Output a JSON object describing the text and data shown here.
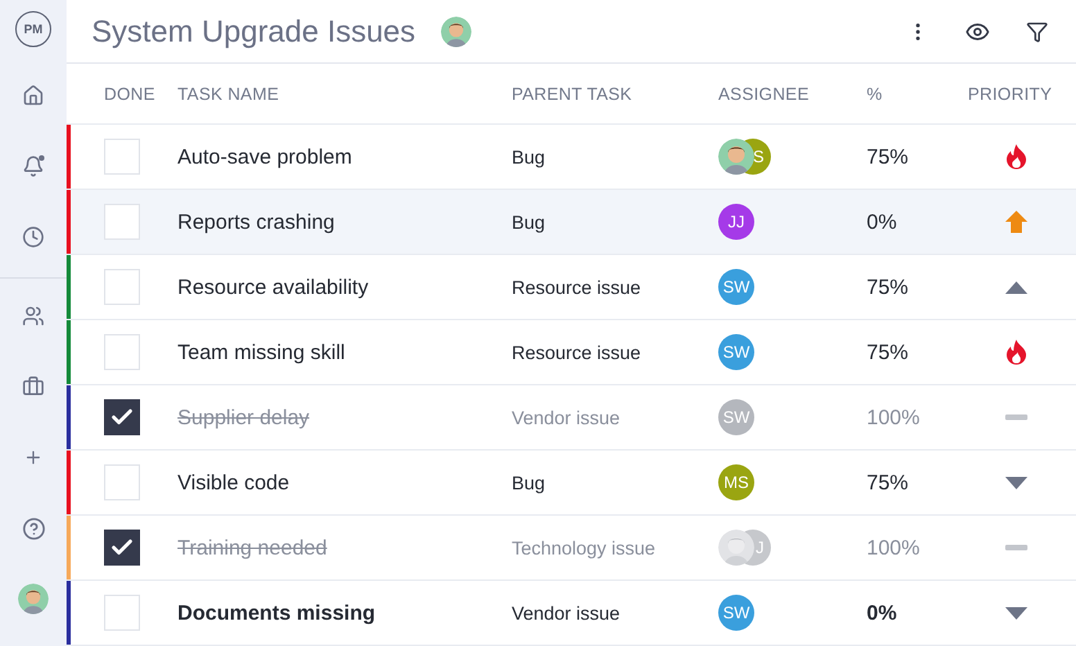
{
  "sidebar": {
    "logo": "PM",
    "items": [
      {
        "kind": "home"
      },
      {
        "kind": "bell"
      },
      {
        "kind": "clock"
      },
      {
        "kind": "users"
      },
      {
        "kind": "briefcase"
      },
      {
        "kind": "plus"
      },
      {
        "kind": "help"
      },
      {
        "kind": "avatar"
      }
    ]
  },
  "header": {
    "title": "System Upgrade Issues"
  },
  "table": {
    "columns": [
      "DONE",
      "TASK NAME",
      "PARENT TASK",
      "ASSIGNEE",
      "%",
      "PRIORITY"
    ],
    "rows": [
      {
        "done": false,
        "selected": false,
        "bold": false,
        "color": "#e8101f",
        "task": "Auto-save problem",
        "parent": "Bug",
        "assignees": [
          {
            "kind": "face"
          },
          {
            "kind": "initials",
            "initials": "S",
            "color": "#9aa511"
          }
        ],
        "percent": "75%",
        "priority": {
          "kind": "flame"
        }
      },
      {
        "done": false,
        "selected": true,
        "bold": false,
        "color": "#e8101f",
        "task": "Reports crashing",
        "parent": "Bug",
        "assignees": [
          {
            "kind": "initials",
            "initials": "JJ",
            "color": "#a53ae8"
          }
        ],
        "percent": "0%",
        "priority": {
          "kind": "arrow"
        }
      },
      {
        "done": false,
        "selected": false,
        "bold": false,
        "color": "#148a3a",
        "task": "Resource availability",
        "parent": "Resource issue",
        "assignees": [
          {
            "kind": "initials",
            "initials": "SW",
            "color": "#3a9fdd"
          }
        ],
        "percent": "75%",
        "priority": {
          "kind": "up"
        }
      },
      {
        "done": false,
        "selected": false,
        "bold": false,
        "color": "#148a3a",
        "task": "Team missing skill",
        "parent": "Resource issue",
        "assignees": [
          {
            "kind": "initials",
            "initials": "SW",
            "color": "#3a9fdd"
          }
        ],
        "percent": "75%",
        "priority": {
          "kind": "flame"
        }
      },
      {
        "done": true,
        "selected": false,
        "bold": false,
        "color": "#2b2f9e",
        "task": "Supplier delay",
        "parent": "Vendor issue",
        "assignees": [
          {
            "kind": "initials",
            "initials": "SW",
            "color": "#b4b7bd"
          }
        ],
        "percent": "100%",
        "priority": {
          "kind": "dash"
        }
      },
      {
        "done": false,
        "selected": false,
        "bold": false,
        "color": "#e8101f",
        "task": "Visible code",
        "parent": "Bug",
        "assignees": [
          {
            "kind": "initials",
            "initials": "MS",
            "color": "#9aa511"
          }
        ],
        "percent": "75%",
        "priority": {
          "kind": "down"
        }
      },
      {
        "done": true,
        "selected": false,
        "bold": false,
        "color": "#f6a95a",
        "task": "Training needed",
        "parent": "Technology issue",
        "assignees": [
          {
            "kind": "face"
          },
          {
            "kind": "initials",
            "initials": "J",
            "color": "#c6c8cc"
          }
        ],
        "percent": "100%",
        "priority": {
          "kind": "dash"
        }
      },
      {
        "done": false,
        "selected": false,
        "bold": true,
        "color": "#2b2f9e",
        "task": "Documents missing",
        "parent": "Vendor issue",
        "assignees": [
          {
            "kind": "initials",
            "initials": "SW",
            "color": "#3a9fdd"
          }
        ],
        "percent": "0%",
        "priority": {
          "kind": "down"
        }
      }
    ]
  }
}
